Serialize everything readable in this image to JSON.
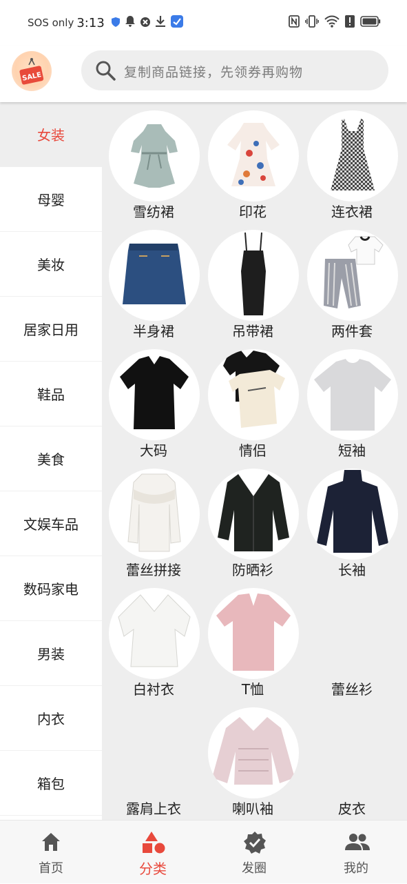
{
  "status_bar": {
    "carrier": "SOS only",
    "time": "3:13"
  },
  "header": {
    "logo_text": "SALE",
    "search_placeholder": "复制商品链接，先领券再购物"
  },
  "sidebar": {
    "items": [
      {
        "label": "女装",
        "active": true
      },
      {
        "label": "母婴"
      },
      {
        "label": "美妆"
      },
      {
        "label": "居家日用"
      },
      {
        "label": "鞋品"
      },
      {
        "label": "美食"
      },
      {
        "label": "文娱车品"
      },
      {
        "label": "数码家电"
      },
      {
        "label": "男装"
      },
      {
        "label": "内衣"
      },
      {
        "label": "箱包"
      }
    ]
  },
  "categories": [
    {
      "label": "雪纺裙"
    },
    {
      "label": "印花"
    },
    {
      "label": "连衣裙"
    },
    {
      "label": "半身裙"
    },
    {
      "label": "吊带裙"
    },
    {
      "label": "两件套"
    },
    {
      "label": "大码"
    },
    {
      "label": "情侣"
    },
    {
      "label": "短袖"
    },
    {
      "label": "蕾丝拼接"
    },
    {
      "label": "防晒衫"
    },
    {
      "label": "长袖"
    },
    {
      "label": "白衬衣"
    },
    {
      "label": "T恤"
    },
    {
      "label": "蕾丝衫"
    },
    {
      "label": "露肩上衣"
    },
    {
      "label": "喇叭袖"
    },
    {
      "label": "皮衣"
    }
  ],
  "bottom_nav": [
    {
      "label": "首页",
      "icon": "home-icon"
    },
    {
      "label": "分类",
      "icon": "category-icon",
      "active": true
    },
    {
      "label": "发圈",
      "icon": "badge-check-icon"
    },
    {
      "label": "我的",
      "icon": "people-icon"
    }
  ],
  "colors": {
    "accent": "#e8493c",
    "panel": "#eeeeee"
  }
}
